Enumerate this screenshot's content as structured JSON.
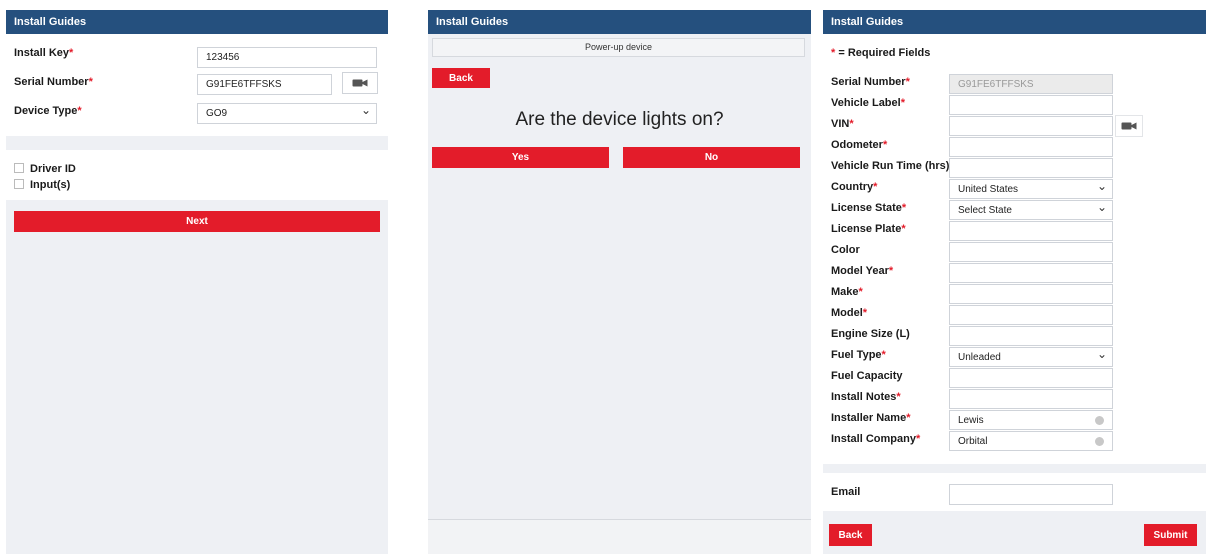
{
  "left": {
    "header": "Install Guides",
    "install_key": {
      "label": "Install Key",
      "value": "123456"
    },
    "serial_number": {
      "label": "Serial Number",
      "value": "G91FE6TFFSKS"
    },
    "device_type": {
      "label": "Device Type",
      "value": "GO9"
    },
    "checkboxes": [
      "Driver ID",
      "Input(s)"
    ],
    "next_label": "Next"
  },
  "middle": {
    "header": "Install Guides",
    "step": "Power-up device",
    "back_label": "Back",
    "question": "Are the device lights on?",
    "yes_label": "Yes",
    "no_label": "No"
  },
  "right": {
    "header": "Install Guides",
    "required_note": "= Required Fields",
    "required_star": "*",
    "fields": [
      {
        "label": "Serial Number",
        "required": true,
        "value": "G91FE6TFFSKS",
        "kind": "readonly"
      },
      {
        "label": "Vehicle Label",
        "required": true,
        "value": "",
        "kind": "text"
      },
      {
        "label": "VIN",
        "required": true,
        "value": "",
        "kind": "text-cam"
      },
      {
        "label": "Odometer",
        "required": true,
        "value": "",
        "kind": "text"
      },
      {
        "label": "Vehicle Run Time (hrs)",
        "required": false,
        "value": "",
        "kind": "text"
      },
      {
        "label": "Country",
        "required": true,
        "value": "United States",
        "kind": "select"
      },
      {
        "label": "License State",
        "required": true,
        "value": "Select State",
        "kind": "select"
      },
      {
        "label": "License Plate",
        "required": true,
        "value": "",
        "kind": "text"
      },
      {
        "label": "Color",
        "required": false,
        "value": "",
        "kind": "text"
      },
      {
        "label": "Model Year",
        "required": true,
        "value": "",
        "kind": "text"
      },
      {
        "label": "Make",
        "required": true,
        "value": "",
        "kind": "text"
      },
      {
        "label": "Model",
        "required": true,
        "value": "",
        "kind": "text"
      },
      {
        "label": "Engine Size (L)",
        "required": false,
        "value": "",
        "kind": "text"
      },
      {
        "label": "Fuel Type",
        "required": true,
        "value": "Unleaded",
        "kind": "select"
      },
      {
        "label": "Fuel Capacity",
        "required": false,
        "value": "",
        "kind": "text"
      },
      {
        "label": "Install Notes",
        "required": true,
        "value": "",
        "kind": "text"
      },
      {
        "label": "Installer Name",
        "required": true,
        "value": "Lewis",
        "kind": "clearable"
      },
      {
        "label": "Install Company",
        "required": true,
        "value": "Orbital",
        "kind": "clearable"
      }
    ],
    "email_label": "Email",
    "email_value": "",
    "back_label": "Back",
    "submit_label": "Submit"
  },
  "colors": {
    "header": "#25507e",
    "accent": "#e31c2a",
    "panel_bg": "#eef0f4"
  },
  "icons": [
    "camera-icon",
    "chevron-down-icon",
    "clear-icon"
  ]
}
